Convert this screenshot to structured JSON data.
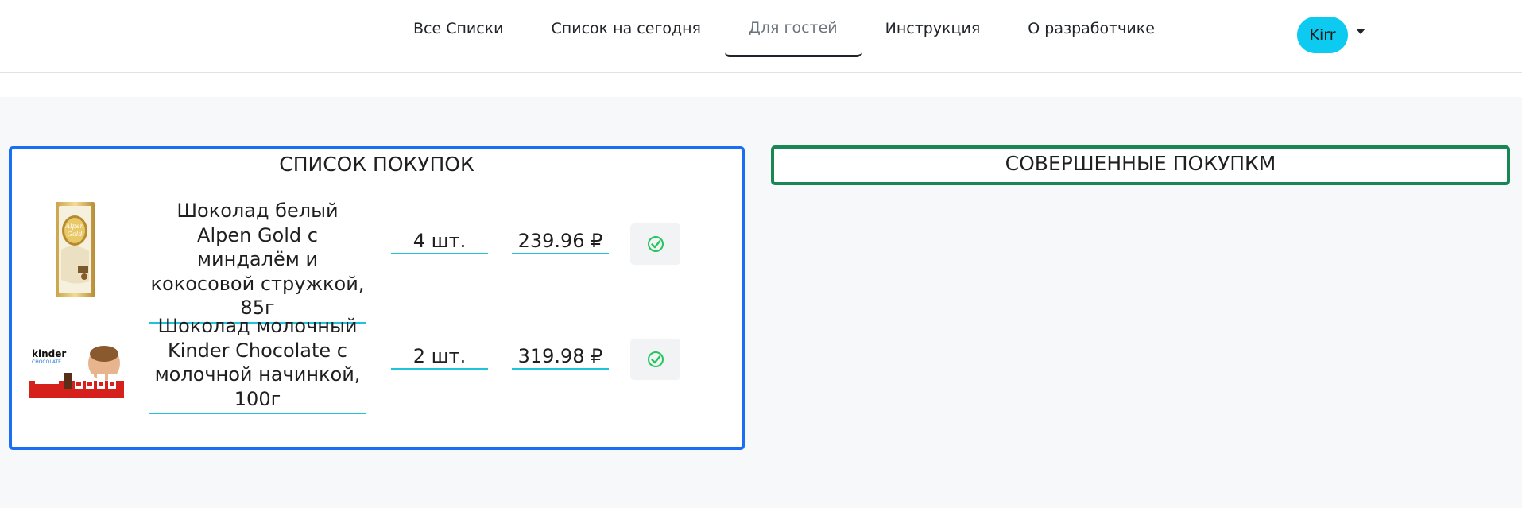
{
  "nav": {
    "items": [
      {
        "label": "Все Списки",
        "active": false
      },
      {
        "label": "Список на сегодня",
        "active": false
      },
      {
        "label": "Для гостей",
        "active": true
      },
      {
        "label": "Инструкция",
        "active": false
      },
      {
        "label": "О разработчике",
        "active": false
      }
    ],
    "user": {
      "name": "Kirr"
    }
  },
  "shopping_list": {
    "title": "СПИСОК ПОКУПОК",
    "items": [
      {
        "name": "Шоколад белый Alpen Gold с миндалём и кокосовой стружкой, 85г",
        "quantity": "4 шт.",
        "price": "239.96 ₽",
        "image_icon": "alpen-gold-chocolate-image"
      },
      {
        "name": "Шоколад молочный Kinder Chocolate с молочной начинкой, 100г",
        "quantity": "2 шт.",
        "price": "319.98 ₽",
        "image_icon": "kinder-chocolate-image"
      }
    ]
  },
  "completed": {
    "title": "СОВЕРШЕННЫЕ ПОКУПКМ"
  },
  "colors": {
    "list_border": "#1a6ef5",
    "completed_border": "#198754",
    "avatar_bg": "#0dcaf0",
    "field_underline": "#20c3d9",
    "check_icon": "#22c55e"
  }
}
